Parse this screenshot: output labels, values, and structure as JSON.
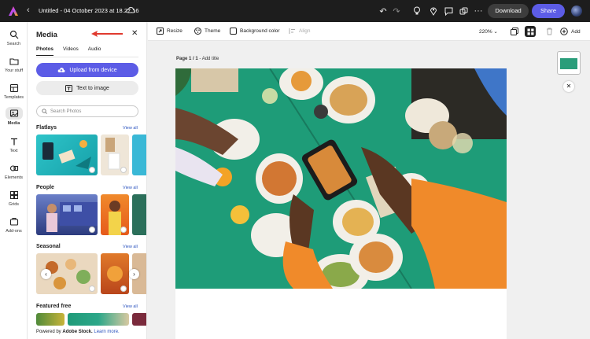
{
  "topbar": {
    "title": "Untitled - 04 October 2023 at 18.27.16",
    "download_label": "Download",
    "share_label": "Share",
    "icons": [
      "adobe-express-logo",
      "back-chevron",
      "cloud",
      "undo",
      "redo",
      "lightbulb",
      "location",
      "comment",
      "share-link",
      "more"
    ]
  },
  "rail": {
    "items": [
      {
        "label": "Search",
        "icon": "search-icon"
      },
      {
        "label": "Your stuff",
        "icon": "folder-icon"
      },
      {
        "label": "Templates",
        "icon": "templates-icon"
      },
      {
        "label": "Media",
        "icon": "media-icon"
      },
      {
        "label": "Text",
        "icon": "text-icon"
      },
      {
        "label": "Elements",
        "icon": "elements-icon"
      },
      {
        "label": "Grids",
        "icon": "grids-icon"
      },
      {
        "label": "Add-ons",
        "icon": "addons-icon"
      }
    ]
  },
  "panel": {
    "title": "Media",
    "tabs": [
      "Photos",
      "Videos",
      "Audio"
    ],
    "upload_label": "Upload from device",
    "text_to_image_label": "Text to image",
    "search_placeholder": "Search Photos",
    "sections": [
      {
        "title": "Flatlays",
        "view_all": "View all"
      },
      {
        "title": "People",
        "view_all": "View all"
      },
      {
        "title": "Seasonal",
        "view_all": "View all"
      },
      {
        "title": "Featured free",
        "view_all": "View all"
      }
    ],
    "footer_prefix": "Powered by ",
    "footer_brand": "Adobe Stock.",
    "footer_link": "Learn more."
  },
  "canvas_toolbar": {
    "resize": "Resize",
    "theme": "Theme",
    "background_color": "Background color",
    "align": "Align",
    "zoom": "220%",
    "add": "Add"
  },
  "workspace": {
    "page_number": "Page 1 / 1",
    "separator": " - ",
    "add_title": "Add title"
  },
  "colors": {
    "accent": "#5c5ce6",
    "topbar": "#1d1d1d",
    "link": "#2a52be",
    "annotation_arrow": "#e03a2f"
  }
}
